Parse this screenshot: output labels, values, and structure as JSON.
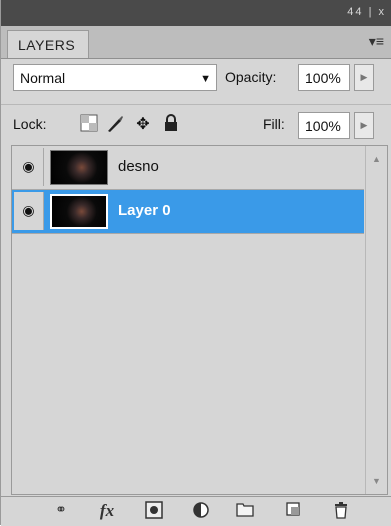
{
  "titlebar": {
    "collapse_icon": "double-chevron-left-icon",
    "close_icon": "close-icon",
    "controls_text": "44 | x"
  },
  "panel": {
    "tab_label": "LAYERS",
    "menu_icon": "panel-menu-icon"
  },
  "blend": {
    "mode": "Normal",
    "opacity_label": "Opacity:",
    "opacity_value": "100%"
  },
  "lock": {
    "label": "Lock:",
    "icons": [
      "lock-transparent-pixels-icon",
      "lock-image-pixels-icon",
      "lock-position-icon",
      "lock-all-icon"
    ],
    "fill_label": "Fill:",
    "fill_value": "100%"
  },
  "layers": [
    {
      "name": "desno",
      "visible": true,
      "selected": false
    },
    {
      "name": "Layer 0",
      "visible": true,
      "selected": true
    }
  ],
  "bottom_icons": [
    "link-layers-icon",
    "layer-style-fx-icon",
    "add-mask-icon",
    "adjustment-layer-icon",
    "new-group-icon",
    "new-layer-icon",
    "delete-layer-icon"
  ],
  "bottom_fx_text": "fx",
  "colors": {
    "selection": "#3a9ae8",
    "panel_bg": "#d6d6d6",
    "titlebar_bg": "#4a4a4a"
  }
}
